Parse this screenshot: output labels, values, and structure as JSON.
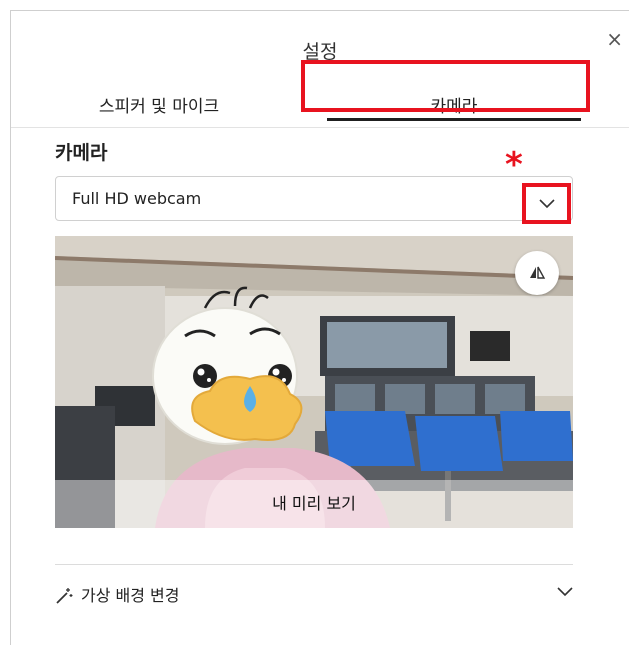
{
  "dialog": {
    "title": "설정",
    "close_symbol": "×"
  },
  "tabs": [
    {
      "label": "스피커 및 마이크",
      "selected": false
    },
    {
      "label": "카메라",
      "selected": true
    }
  ],
  "camera": {
    "section_label": "카메라",
    "selected_device": "Full HD webcam",
    "annotation_mark": "*",
    "preview_label": "내 미리 보기",
    "flip_icon": "mirror-flip-icon"
  },
  "virtual_background": {
    "label": "가상 배경 변경",
    "icon": "magic-wand-icon"
  },
  "colors": {
    "highlight": "#e8131f",
    "tab_underline": "#1f1f1f"
  }
}
